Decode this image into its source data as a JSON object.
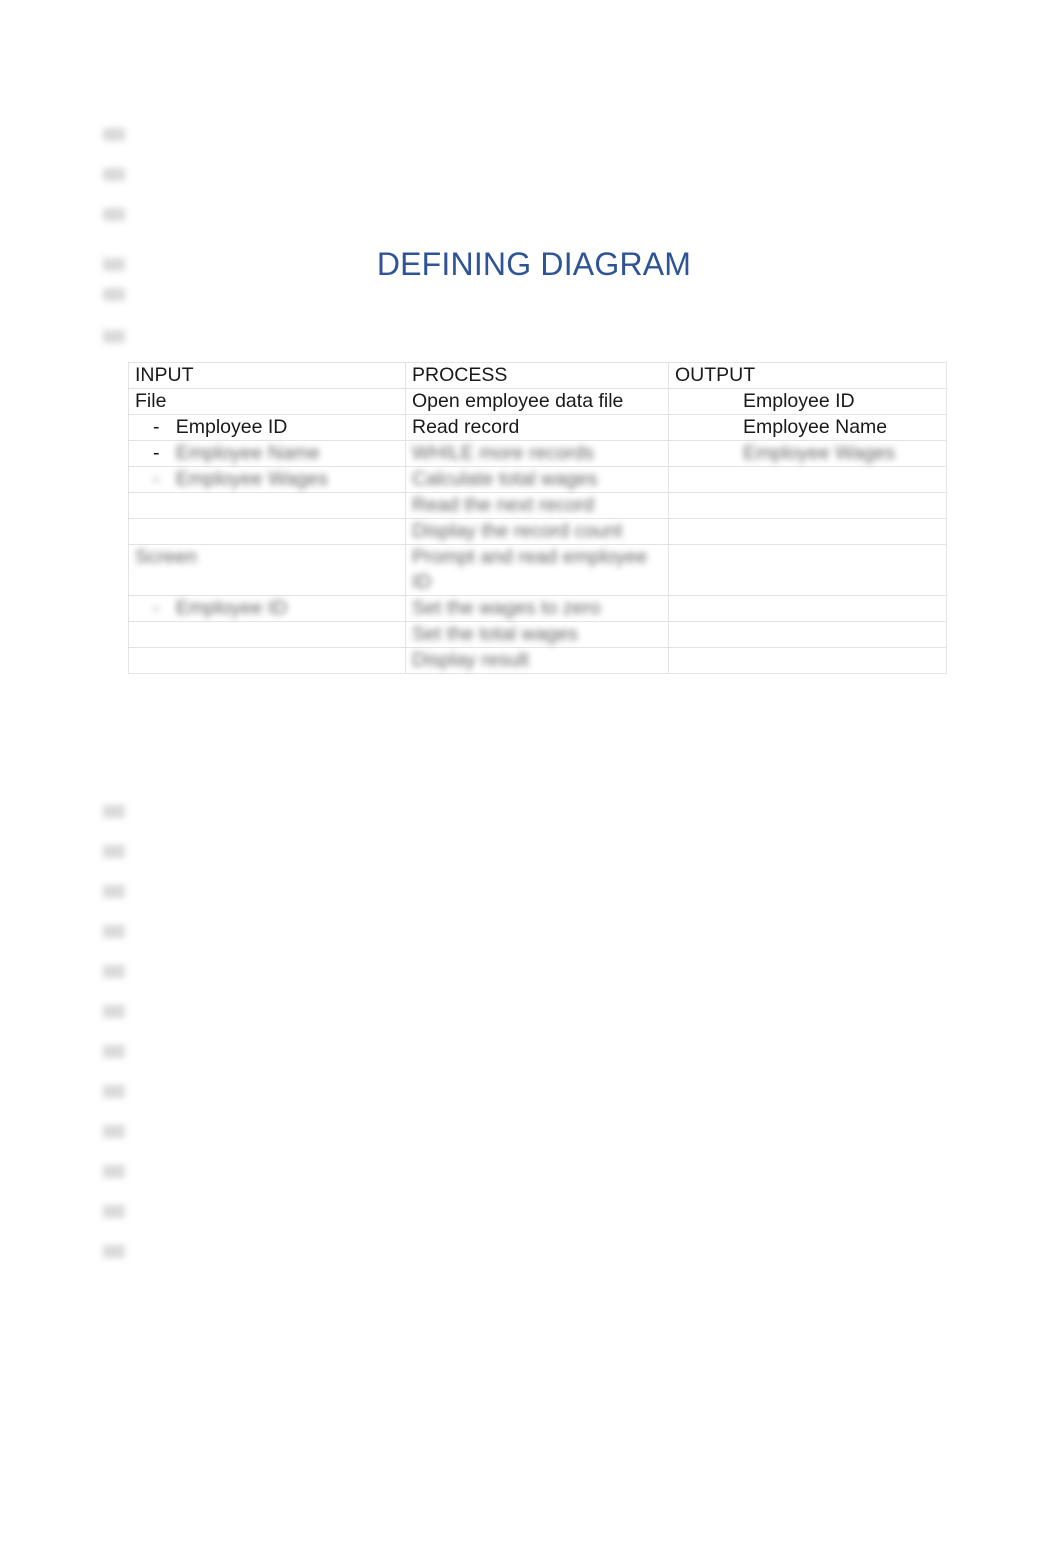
{
  "document": {
    "title": "DEFINING DIAGRAM",
    "title_color": "#2e5496",
    "background_color": "#ffffff"
  },
  "table": {
    "border_color": "#e3e3e3",
    "columns": [
      "INPUT",
      "PROCESS",
      "OUTPUT"
    ],
    "rows": [
      {
        "input": "File",
        "process": "Open employee data file",
        "output": "Employee ID",
        "input_blurred": false,
        "process_blurred": false,
        "output_blurred": false
      },
      {
        "input": "-   Employee ID",
        "process": "Read record",
        "output": "Employee Name",
        "input_blurred": false,
        "process_blurred": false,
        "output_blurred": false
      },
      {
        "input": "-   Employee Name",
        "process": "WHILE more records",
        "output": "Employee Wages",
        "input_blurred": true,
        "process_blurred": true,
        "output_blurred": true
      },
      {
        "input": "-   Employee Wages",
        "process": "Calculate total wages",
        "output": "",
        "input_blurred": true,
        "process_blurred": true,
        "output_blurred": false
      },
      {
        "input": "",
        "process": "Read the next record",
        "output": "",
        "input_blurred": false,
        "process_blurred": true,
        "output_blurred": false
      },
      {
        "input": "",
        "process": "Display the record count",
        "output": "",
        "input_blurred": false,
        "process_blurred": true,
        "output_blurred": false
      },
      {
        "input": "Screen",
        "process": "Prompt and read employee ID",
        "output": "",
        "input_blurred": true,
        "process_blurred": true,
        "output_blurred": false
      },
      {
        "input": "-   Employee ID",
        "process": "Set the wages to zero",
        "output": "",
        "input_blurred": true,
        "process_blurred": true,
        "output_blurred": false
      },
      {
        "input": "",
        "process": "Set the total wages",
        "output": "",
        "input_blurred": false,
        "process_blurred": true,
        "output_blurred": false
      },
      {
        "input": "",
        "process": "Display result",
        "output": "",
        "input_blurred": false,
        "process_blurred": true,
        "output_blurred": false
      }
    ]
  },
  "margin_marks": {
    "count": 18,
    "positions": [
      128,
      168,
      208,
      258,
      288,
      330,
      805,
      845,
      885,
      925,
      965,
      1005,
      1045,
      1085,
      1125,
      1165,
      1205,
      1245
    ]
  }
}
